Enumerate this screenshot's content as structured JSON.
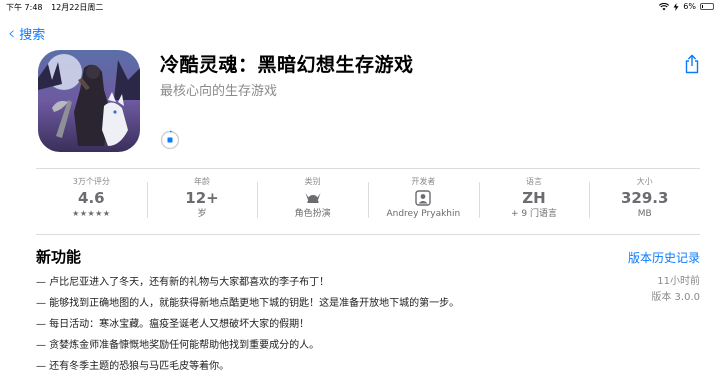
{
  "status_bar": {
    "time": "下午 7:48",
    "date": "12月22日周二",
    "battery": "6%"
  },
  "nav": {
    "back_label": "搜索"
  },
  "app": {
    "title": "冷酷灵魂：黑暗幻想生存游戏",
    "subtitle": "最核心向的生存游戏"
  },
  "stats": [
    {
      "label": "3万个评分",
      "value": "4.6",
      "sub": "★★★★★",
      "stars": 4.6
    },
    {
      "label": "年龄",
      "value": "12+",
      "sub": "岁"
    },
    {
      "label": "类别",
      "icon": "viking-helmet-icon",
      "sub": "角色扮演"
    },
    {
      "label": "开发者",
      "icon": "developer-portrait-icon",
      "sub": "Andrey Pryakhin"
    },
    {
      "label": "语言",
      "value": "ZH",
      "sub": "+ 9 门语言"
    },
    {
      "label": "大小",
      "value": "329.3",
      "sub": "MB"
    }
  ],
  "whats_new": {
    "title": "新功能",
    "history_link": "版本历史记录",
    "time_ago": "11小时前",
    "version": "版本 3.0.0",
    "notes": [
      "— 卢比尼亚进入了冬天，还有新的礼物与大家都喜欢的李子布丁！",
      "— 能够找到正确地图的人，就能获得新地点酷更地下城的钥匙！这是准备开放地下城的第一步。",
      "— 每日活动：寒冰宝藏。瘟疫圣诞老人又想破坏大家的假期！",
      "— 贪婪炼金师准备慷慨地奖励任何能帮助他找到重要成分的人。",
      "— 还有冬季主题的恐狼与马匹毛皮等着你。"
    ]
  },
  "colors": {
    "accent": "#0a7aff",
    "secondary_text": "#8a8a8e"
  }
}
